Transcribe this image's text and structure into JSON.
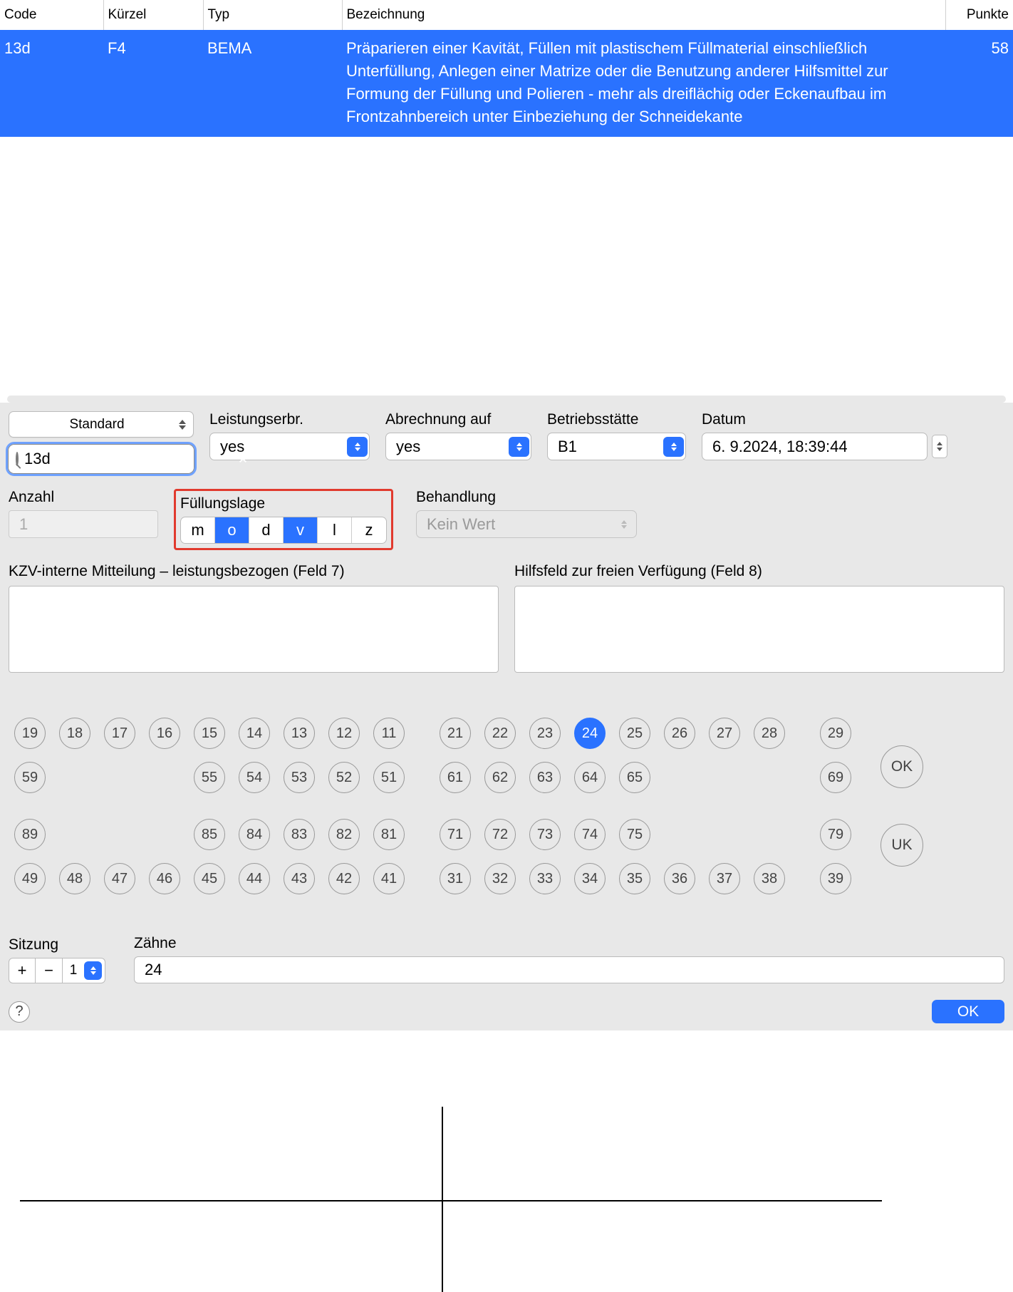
{
  "table": {
    "headers": {
      "code": "Code",
      "kurzel": "Kürzel",
      "typ": "Typ",
      "bez": "Bezeichnung",
      "punkte": "Punkte"
    },
    "row": {
      "code": "13d",
      "kurzel": "F4",
      "typ": "BEMA",
      "bez": "Präparieren einer Kavität, Füllen mit plastischem Füllmaterial einschließlich Unterfüllung, Anlegen einer Matrize oder die Benutzung anderer Hilfsmittel zur Formung der Füllung und Polieren - mehr als dreiflächig oder Eckenaufbau im Frontzahnbereich unter Einbeziehung der Schneidekante",
      "punkte": "58"
    }
  },
  "standard_dd": "Standard",
  "search_value": "13d",
  "fields": {
    "leistungserbr_label": "Leistungserbr.",
    "leistungserbr_value": "yes",
    "abrechnung_label": "Abrechnung auf",
    "abrechnung_value": "yes",
    "betriebs_label": "Betriebsstätte",
    "betriebs_value": "B1",
    "datum_label": "Datum",
    "datum_value": "6.  9.2024, 18:39:44"
  },
  "anzahl": {
    "label": "Anzahl",
    "value": "1"
  },
  "fuellungslage": {
    "label": "Füllungslage",
    "m": "m",
    "o": "o",
    "d": "d",
    "v": "v",
    "l": "l",
    "z": "z"
  },
  "behandlung": {
    "label": "Behandlung",
    "value": "Kein Wert"
  },
  "kzv_label": "KZV-interne Mitteilung – leistungsbezogen (Feld 7)",
  "hilfs_label": "Hilfsfeld zur freien Verfügung (Feld 8)",
  "teeth": {
    "r1": [
      "19",
      "18",
      "17",
      "16",
      "15",
      "14",
      "13",
      "12",
      "11"
    ],
    "r1b": [
      "21",
      "22",
      "23",
      "24",
      "25",
      "26",
      "27",
      "28"
    ],
    "r1c": "29",
    "r2a": "59",
    "r2": [
      "55",
      "54",
      "53",
      "52",
      "51"
    ],
    "r2b": [
      "61",
      "62",
      "63",
      "64",
      "65"
    ],
    "r2c": "69",
    "r3a": "89",
    "r3": [
      "85",
      "84",
      "83",
      "82",
      "81"
    ],
    "r3b": [
      "71",
      "72",
      "73",
      "74",
      "75"
    ],
    "r3c": "79",
    "r4": [
      "49",
      "48",
      "47",
      "46",
      "45",
      "44",
      "43",
      "42",
      "41"
    ],
    "r4b": [
      "31",
      "32",
      "33",
      "34",
      "35",
      "36",
      "37",
      "38"
    ],
    "r4c": "39",
    "ok": "OK",
    "uk": "UK"
  },
  "sitzung": {
    "label": "Sitzung",
    "value": "1"
  },
  "zaehne": {
    "label": "Zähne",
    "value": "24"
  },
  "ok_button": "OK",
  "help": "?"
}
